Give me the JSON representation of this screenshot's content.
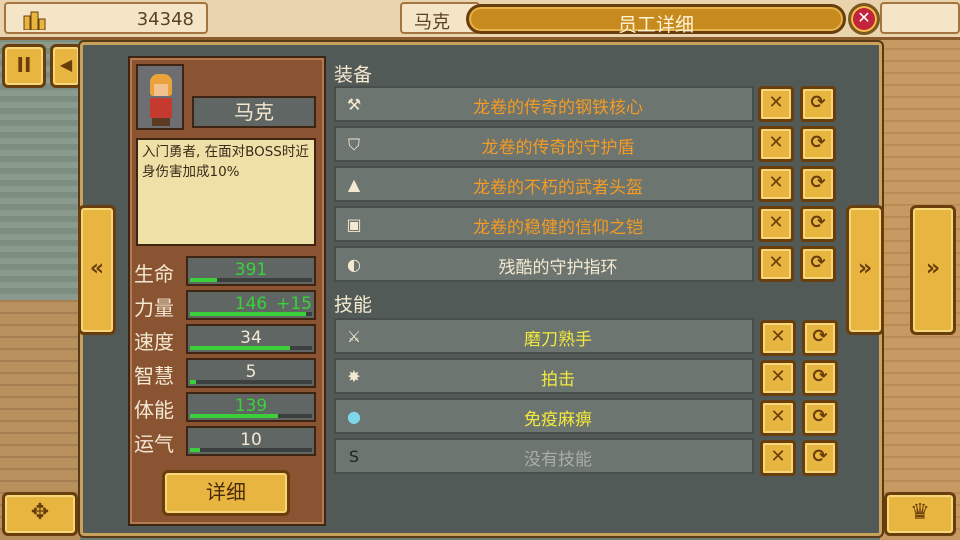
{
  "topbar": {
    "money": "34348",
    "name_preview": "马克",
    "title": "员工详细",
    "close_symbol": "✕"
  },
  "side_buttons": {
    "pause": "II",
    "misc": "◀",
    "move": "✥",
    "crown": "♛",
    "prev": "«",
    "next": "»",
    "next2": "»"
  },
  "profile": {
    "name": "马克",
    "description": "入门勇者, 在面对BOSS时近身伤害加成10%",
    "detail_button": "详细"
  },
  "stats": [
    {
      "label": "生命",
      "value": "391",
      "bonus": "",
      "green": true,
      "fill": 0.22
    },
    {
      "label": "力量",
      "value": "146",
      "bonus": "+15",
      "green": true,
      "fill": 0.95
    },
    {
      "label": "速度",
      "value": "34",
      "bonus": "",
      "green": false,
      "fill": 0.82
    },
    {
      "label": "智慧",
      "value": "5",
      "bonus": "",
      "green": false,
      "fill": 0.05
    },
    {
      "label": "体能",
      "value": "139",
      "bonus": "",
      "green": true,
      "fill": 0.72
    },
    {
      "label": "运气",
      "value": "10",
      "bonus": "",
      "green": false,
      "fill": 0.08
    }
  ],
  "equipment": {
    "title": "装备",
    "items": [
      {
        "name": "龙卷的传奇的钢铁核心",
        "color": "orange",
        "icon": "axe-icon",
        "glyph": "⚒"
      },
      {
        "name": "龙卷的传奇的守护盾",
        "color": "orange",
        "icon": "shield-icon",
        "glyph": "⛉"
      },
      {
        "name": "龙卷的不朽的武者头盔",
        "color": "orange",
        "icon": "helmet-icon",
        "glyph": "▲"
      },
      {
        "name": "龙卷的稳健的信仰之铠",
        "color": "orange",
        "icon": "armor-icon",
        "glyph": "▣"
      },
      {
        "name": "残酷的守护指环",
        "color": "white",
        "icon": "ring-icon",
        "glyph": "◐"
      }
    ]
  },
  "skills": {
    "title": "技能",
    "items": [
      {
        "name": "磨刀熟手",
        "color": "yellow",
        "icon": "sword-icon",
        "glyph": "⚔"
      },
      {
        "name": "拍击",
        "color": "yellow",
        "icon": "burst-icon",
        "glyph": "✸"
      },
      {
        "name": "免疫麻痹",
        "color": "yellow",
        "icon": "orb-icon",
        "glyph": "●"
      },
      {
        "name": "没有技能",
        "color": "gray",
        "icon": "empty-skill-icon",
        "glyph": "S"
      }
    ]
  },
  "row_buttons": {
    "remove": "✕",
    "swap": "⟳"
  }
}
